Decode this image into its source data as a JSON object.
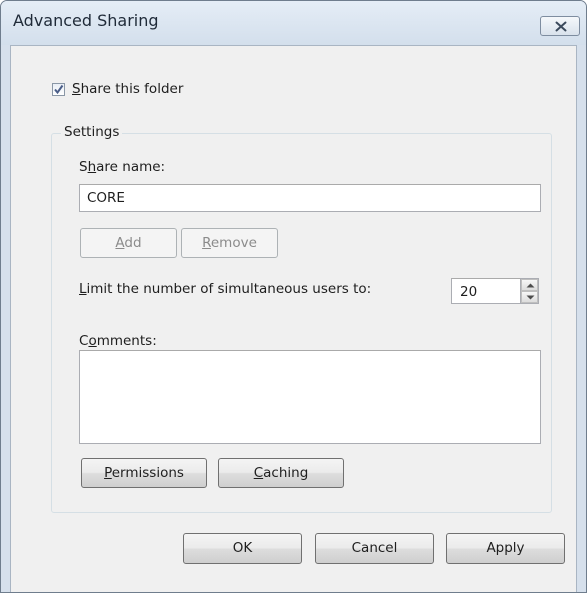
{
  "window": {
    "title": "Advanced Sharing",
    "close_icon": "close-icon"
  },
  "share_checkbox": {
    "label_prefix": "",
    "label_accel": "S",
    "label_rest": "hare this folder",
    "checked": true
  },
  "settings": {
    "legend": "Settings",
    "share_name": {
      "label_prefix": "S",
      "label_accel": "h",
      "label_rest": "are name:",
      "value": "CORE"
    },
    "add_button": {
      "accel": "A",
      "rest": "dd"
    },
    "remove_button": {
      "accel": "R",
      "rest": "emove"
    },
    "limit": {
      "label_accel": "L",
      "label_rest": "imit the number of simultaneous users to:",
      "value": "20"
    },
    "comments": {
      "label_prefix": "C",
      "label_accel": "o",
      "label_rest": "mments:",
      "value": ""
    },
    "permissions_button": {
      "accel": "P",
      "rest": "ermissions"
    },
    "caching_button": {
      "accel": "C",
      "rest": "aching"
    }
  },
  "buttons": {
    "ok": "OK",
    "cancel": "Cancel",
    "apply": "Apply"
  },
  "colors": {
    "window_frame": "#d6e0ec",
    "client": "#f0f0f0",
    "checkmark": "#4a5d88"
  }
}
